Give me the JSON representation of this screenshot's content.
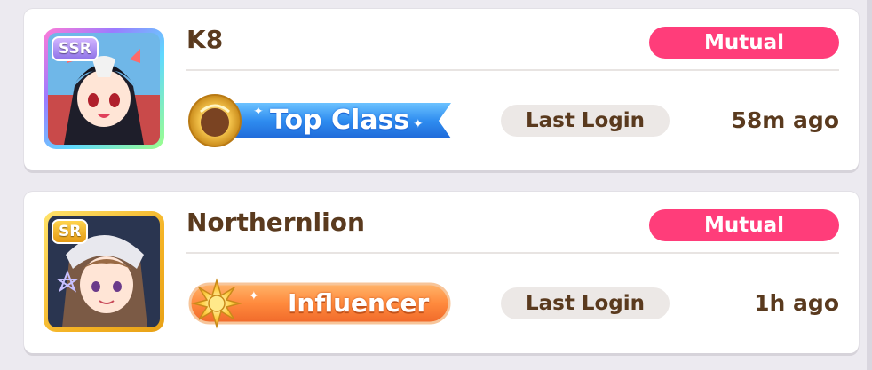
{
  "friends": [
    {
      "rarity": "SSR",
      "name": "K8",
      "tag": "Mutual",
      "title": "Top Class",
      "last_login_label": "Last Login",
      "last_login_time": "58m ago",
      "avatar_icon": "character-portrait-icon"
    },
    {
      "rarity": "SR",
      "name": "Northernlion",
      "tag": "Mutual",
      "title": "Influencer",
      "last_login_label": "Last Login",
      "last_login_time": "1h ago",
      "avatar_icon": "character-portrait-icon"
    }
  ],
  "colors": {
    "mutual_pill": "#ff3d7a",
    "name_text": "#5a3a1e",
    "top_class_banner": "#3a8ef0",
    "influencer_banner": "#ff8a3d"
  }
}
